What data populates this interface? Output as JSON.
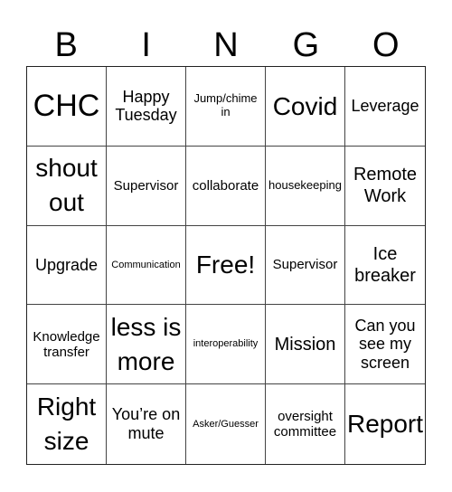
{
  "title_letters": [
    "B",
    "I",
    "N",
    "G",
    "O"
  ],
  "cells": [
    {
      "text": "CHC",
      "size": "s-xl"
    },
    {
      "text": "Happy Tuesday",
      "size": "s-m2"
    },
    {
      "text": "Jump/chime in",
      "size": "s-xs"
    },
    {
      "text": "Covid",
      "size": "s-l"
    },
    {
      "text": "Leverage",
      "size": "s-m2"
    },
    {
      "text": "shout out",
      "size": "s-l"
    },
    {
      "text": "Supervisor",
      "size": "s-s"
    },
    {
      "text": "collaborate",
      "size": "s-s"
    },
    {
      "text": "housekeeping",
      "size": "s-xs"
    },
    {
      "text": "Remote Work",
      "size": "s-m"
    },
    {
      "text": "Upgrade",
      "size": "s-m2"
    },
    {
      "text": "Communication",
      "size": "s-xxs"
    },
    {
      "text": "Free!",
      "size": "s-l"
    },
    {
      "text": "Supervisor",
      "size": "s-s"
    },
    {
      "text": "Ice breaker",
      "size": "s-m"
    },
    {
      "text": "Knowledge transfer",
      "size": "s-s"
    },
    {
      "text": "less is more",
      "size": "s-l"
    },
    {
      "text": "interoperability",
      "size": "s-xxs"
    },
    {
      "text": "Mission",
      "size": "s-m"
    },
    {
      "text": "Can you see my screen",
      "size": "s-m2"
    },
    {
      "text": "Right size",
      "size": "s-l"
    },
    {
      "text": "You’re on mute",
      "size": "s-m2"
    },
    {
      "text": "Asker/Guesser",
      "size": "s-xxs"
    },
    {
      "text": "oversight committee",
      "size": "s-s"
    },
    {
      "text": "Report",
      "size": "s-l"
    }
  ]
}
